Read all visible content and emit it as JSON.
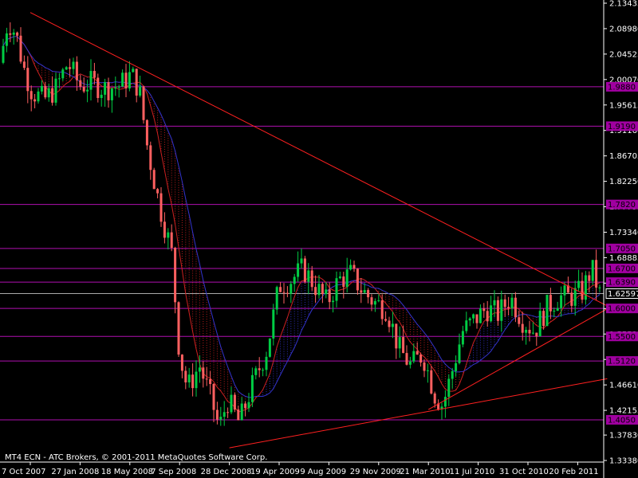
{
  "chart_data": {
    "type": "candlestick",
    "watermark": "MT4 ECN - ATC Brokers, © 2001-2011 MetaQuotes Software Corp.",
    "ylim": [
      1.3338,
      2.13435
    ],
    "y_ticks": [
      "2.13435",
      "2.08980",
      "2.04525",
      "2.00070",
      "1.95615",
      "1.91160",
      "1.86705",
      "1.82250",
      "1.77795",
      "1.73340",
      "1.68885",
      "1.64430",
      "1.59975",
      "1.55520",
      "1.51065",
      "1.46610",
      "1.42155",
      "1.37830",
      "1.33380"
    ],
    "x_ticks": [
      "7 Oct 2007",
      "27 Jan 2008",
      "18 May 2008",
      "7 Sep 2008",
      "28 Dec 2008",
      "19 Apr 2009",
      "9 Aug 2009",
      "29 Nov 2009",
      "21 Mar 2010",
      "11 Jul 2010",
      "31 Oct 2010",
      "20 Feb 2011"
    ],
    "current_price": "1.62597",
    "horizontal_levels": [
      {
        "label": "1.9880",
        "value": 1.988
      },
      {
        "label": "1.9190",
        "value": 1.919
      },
      {
        "label": "1.7820",
        "value": 1.782
      },
      {
        "label": "1.7050",
        "value": 1.705
      },
      {
        "label": "1.6700",
        "value": 1.67
      },
      {
        "label": "1.6390",
        "value": 1.646
      },
      {
        "label": "1.6000",
        "value": 1.6
      },
      {
        "label": "1.5500",
        "value": 1.551
      },
      {
        "label": "1.5120",
        "value": 1.508
      },
      {
        "label": "1.4050",
        "value": 1.405
      }
    ],
    "trendlines": [
      {
        "from": {
          "x": "7 Oct 2007",
          "y": 2.118
        },
        "to": {
          "x": "20 Feb 2011",
          "y": 1.61
        }
      },
      {
        "from": {
          "x": "28 Dec 2008",
          "y": 1.356
        },
        "to": {
          "x": "20 Feb 2011",
          "y": 1.477
        }
      },
      {
        "from": {
          "x": "21 Mar 2010",
          "y": 1.423
        },
        "to": {
          "x": "20 Feb 2011",
          "y": 1.605
        }
      }
    ],
    "colors": {
      "background": "#000000",
      "bull": "#00cc44",
      "bear": "#ff6060",
      "levels": "#b010b0",
      "trendline": "#ff2020",
      "ma_fast": "#cc2020",
      "ma_slow": "#3333cc",
      "axis_text": "#ffffff",
      "label_bg": "#a000a0"
    }
  }
}
